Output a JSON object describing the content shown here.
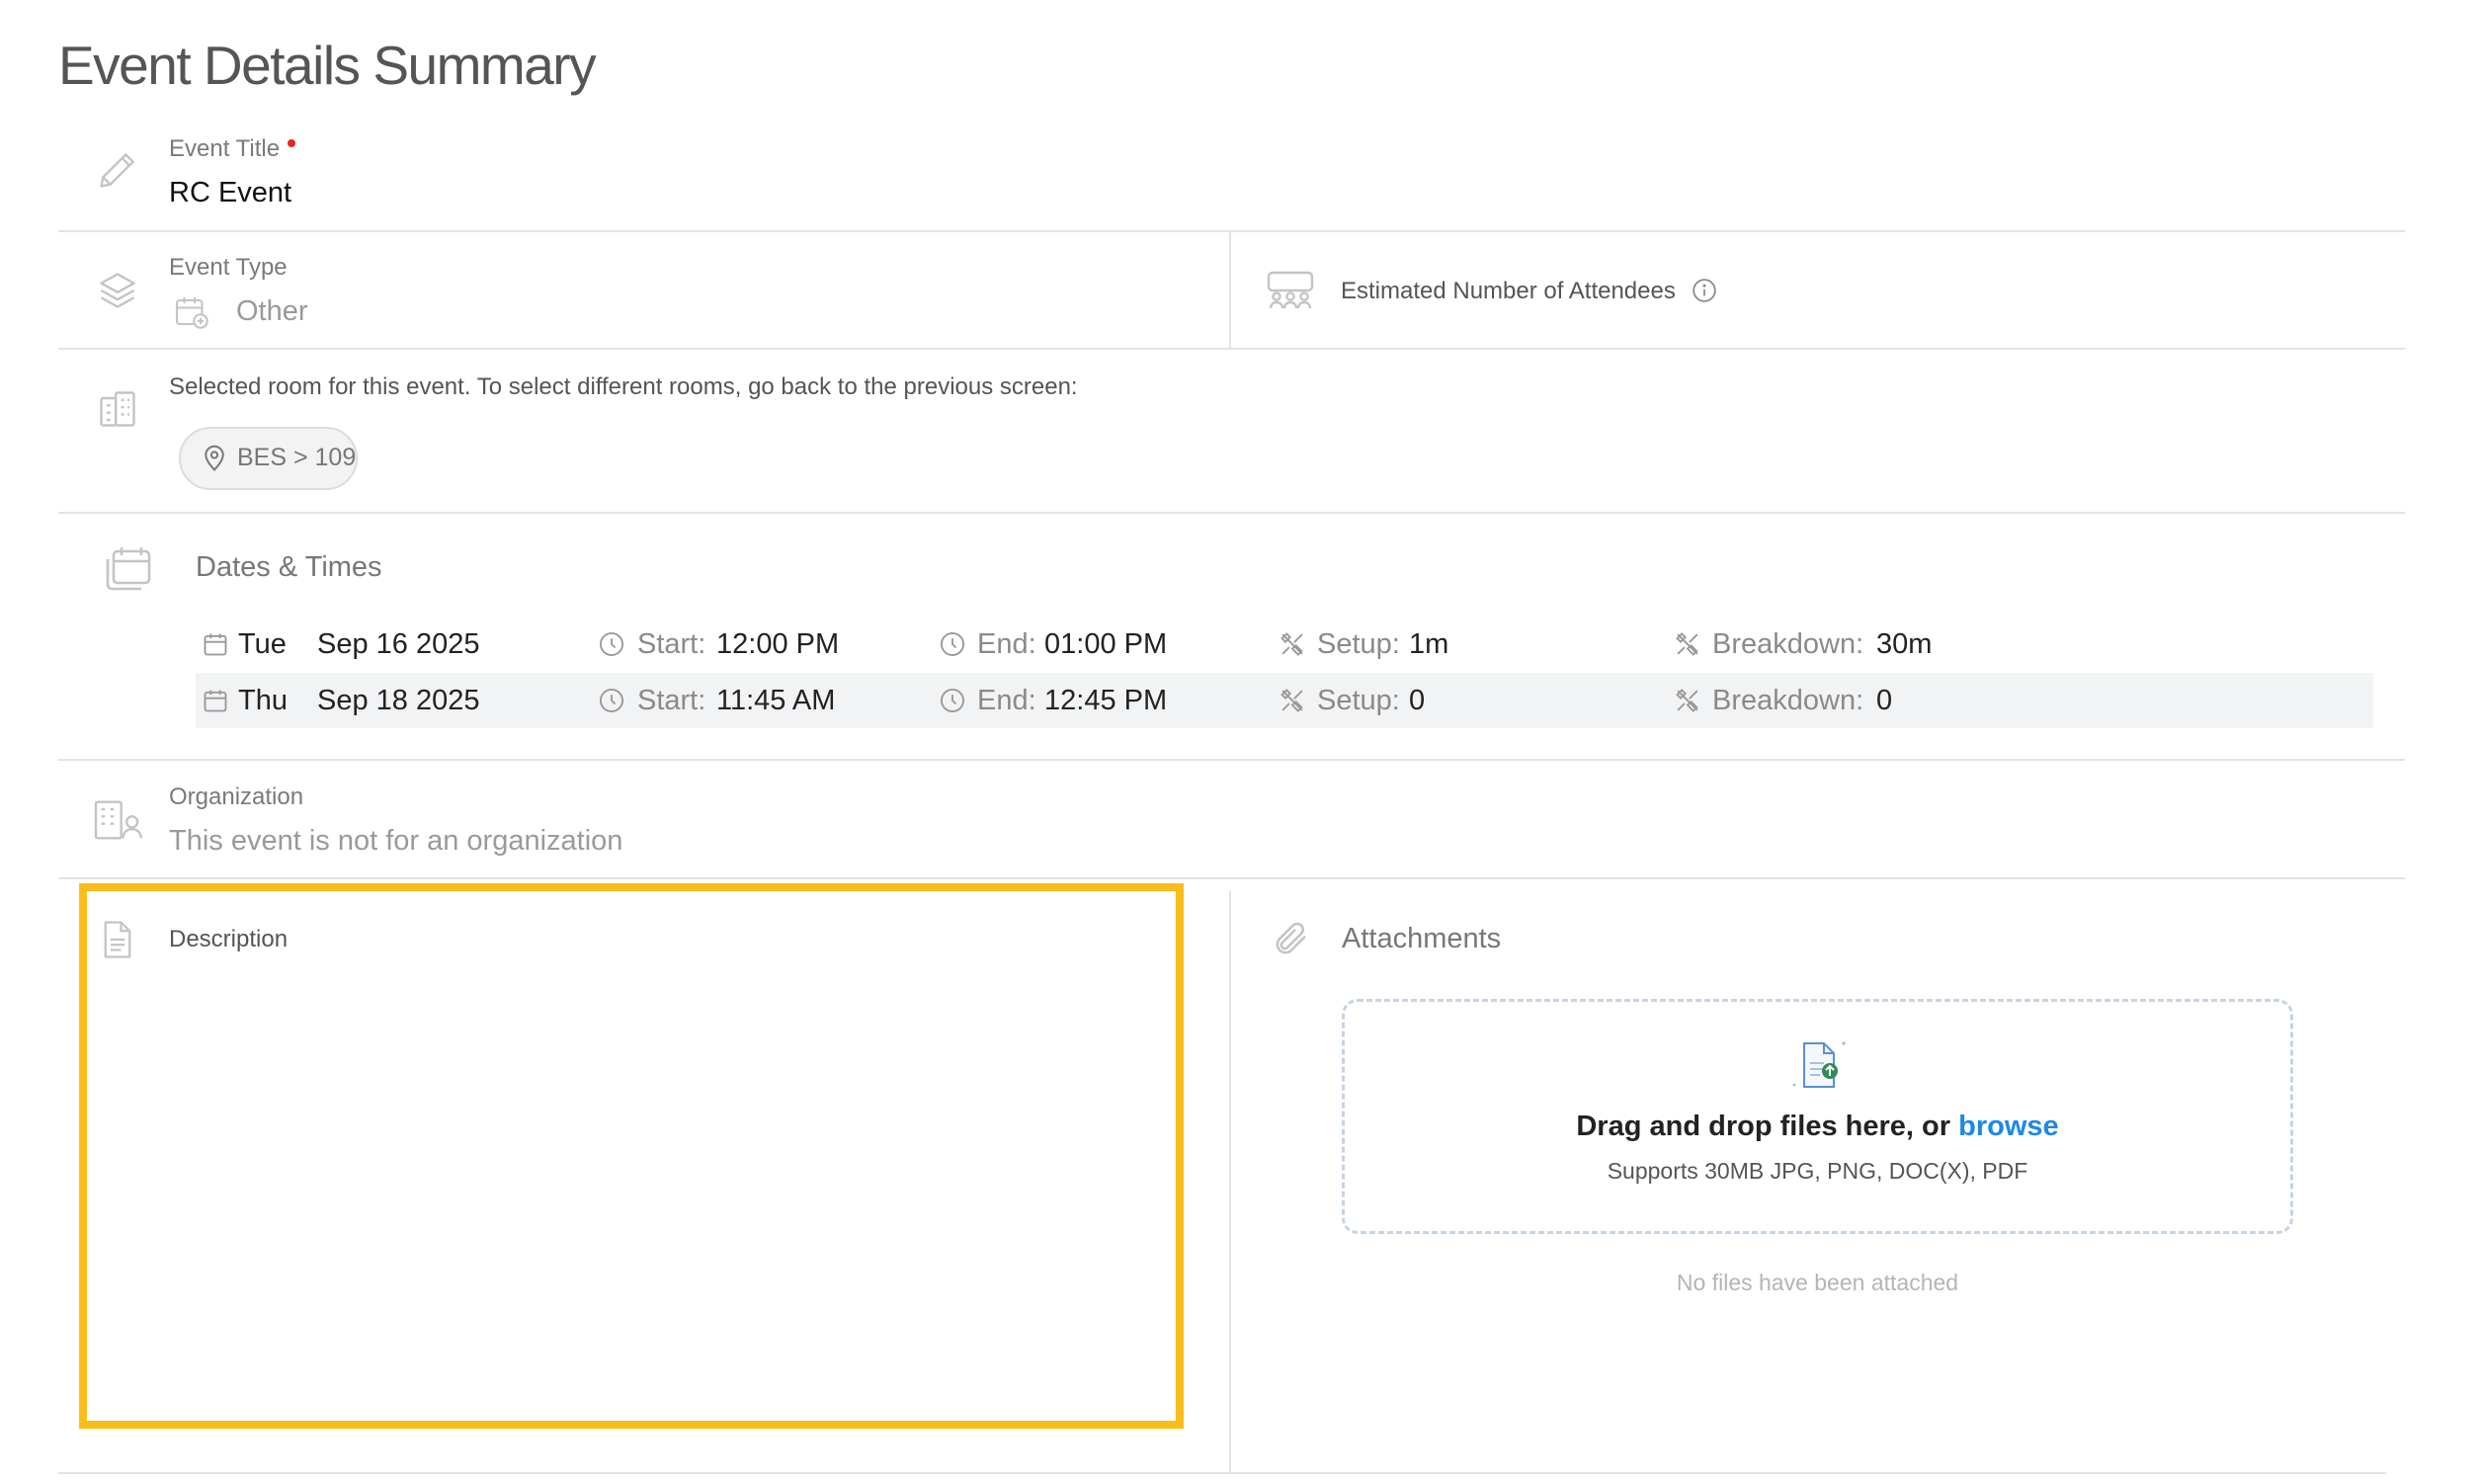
{
  "page": {
    "title": "Event Details Summary"
  },
  "event_title": {
    "label": "Event Title",
    "value": "RC Event"
  },
  "event_type": {
    "label": "Event Type",
    "value": "Other"
  },
  "attendees": {
    "label": "Estimated Number of Attendees"
  },
  "rooms": {
    "note": "Selected room for this event. To select different rooms, go back to the previous screen:",
    "chip": "BES > 109"
  },
  "dates": {
    "heading": "Dates & Times",
    "start_label": "Start:",
    "end_label": "End:",
    "setup_label": "Setup:",
    "breakdown_label": "Breakdown:",
    "rows": [
      {
        "day": "Tue",
        "date": "Sep 16 2025",
        "start": "12:00 PM",
        "end": "01:00 PM",
        "setup": "1m",
        "breakdown": "30m"
      },
      {
        "day": "Thu",
        "date": "Sep 18 2025",
        "start": "11:45 AM",
        "end": "12:45 PM",
        "setup": "0",
        "breakdown": "0"
      }
    ]
  },
  "organization": {
    "label": "Organization",
    "value": "This event is not for an organization"
  },
  "description": {
    "label": "Description"
  },
  "attachments": {
    "label": "Attachments",
    "drop_text": "Drag and drop files here, or",
    "browse": "browse",
    "supports": "Supports 30MB JPG, PNG, DOC(X), PDF",
    "empty": "No files have been attached"
  },
  "colors": {
    "accent": "#1e88e5",
    "highlight": "#fbbd1a",
    "required": "#e5261d"
  }
}
